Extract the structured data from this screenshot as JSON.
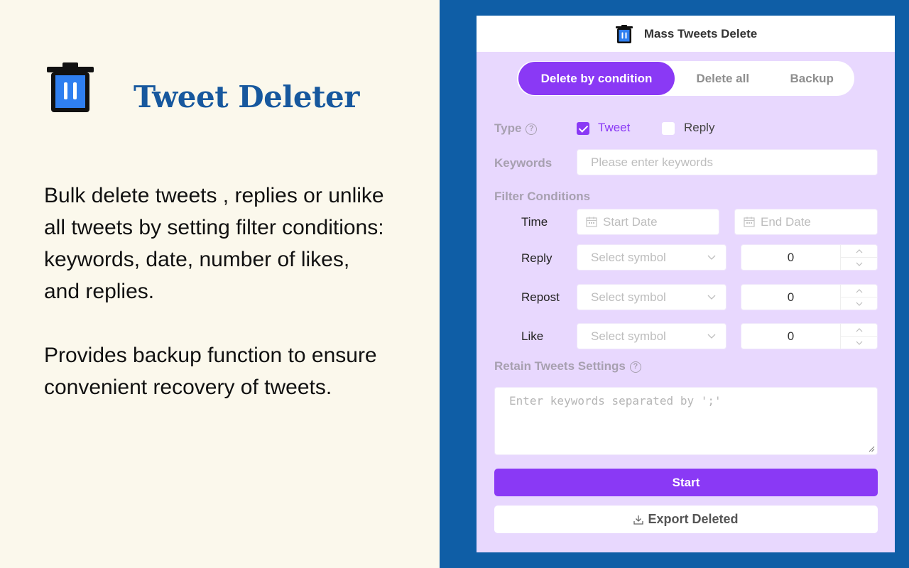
{
  "promo": {
    "title": "Tweet Deleter",
    "paragraph1": "Bulk delete tweets , replies or unlike all tweets  by setting filter conditions: keywords, date, number of likes, and replies.",
    "paragraph2": "Provides backup function to ensure convenient recovery of tweets."
  },
  "popup": {
    "title": "Mass Tweets Delete",
    "tabs": [
      {
        "label": "Delete by condition",
        "active": true
      },
      {
        "label": "Delete all",
        "active": false
      },
      {
        "label": "Backup",
        "active": false
      }
    ],
    "type": {
      "label": "Type",
      "options": [
        {
          "label": "Tweet",
          "checked": true
        },
        {
          "label": "Reply",
          "checked": false
        }
      ]
    },
    "keywords": {
      "label": "Keywords",
      "placeholder": "Please enter keywords",
      "value": ""
    },
    "filter": {
      "label": "Filter Conditions",
      "time": {
        "label": "Time",
        "start_placeholder": "Start Date",
        "end_placeholder": "End Date",
        "separator": "~"
      },
      "rows": [
        {
          "label": "Reply",
          "symbol_placeholder": "Select symbol",
          "value": "0"
        },
        {
          "label": "Repost",
          "symbol_placeholder": "Select symbol",
          "value": "0"
        },
        {
          "label": "Like",
          "symbol_placeholder": "Select symbol",
          "value": "0"
        }
      ]
    },
    "retain": {
      "label": "Retain Tweets Settings",
      "placeholder": "Enter keywords separated by ';'"
    },
    "start_label": "Start",
    "export_label": "Export Deleted"
  },
  "colors": {
    "accent": "#8a39f5",
    "brand_blue": "#17589e",
    "frame_blue": "#0f5ea6",
    "popup_bg": "#e8d8fe",
    "page_bg": "#fbf8ec"
  }
}
